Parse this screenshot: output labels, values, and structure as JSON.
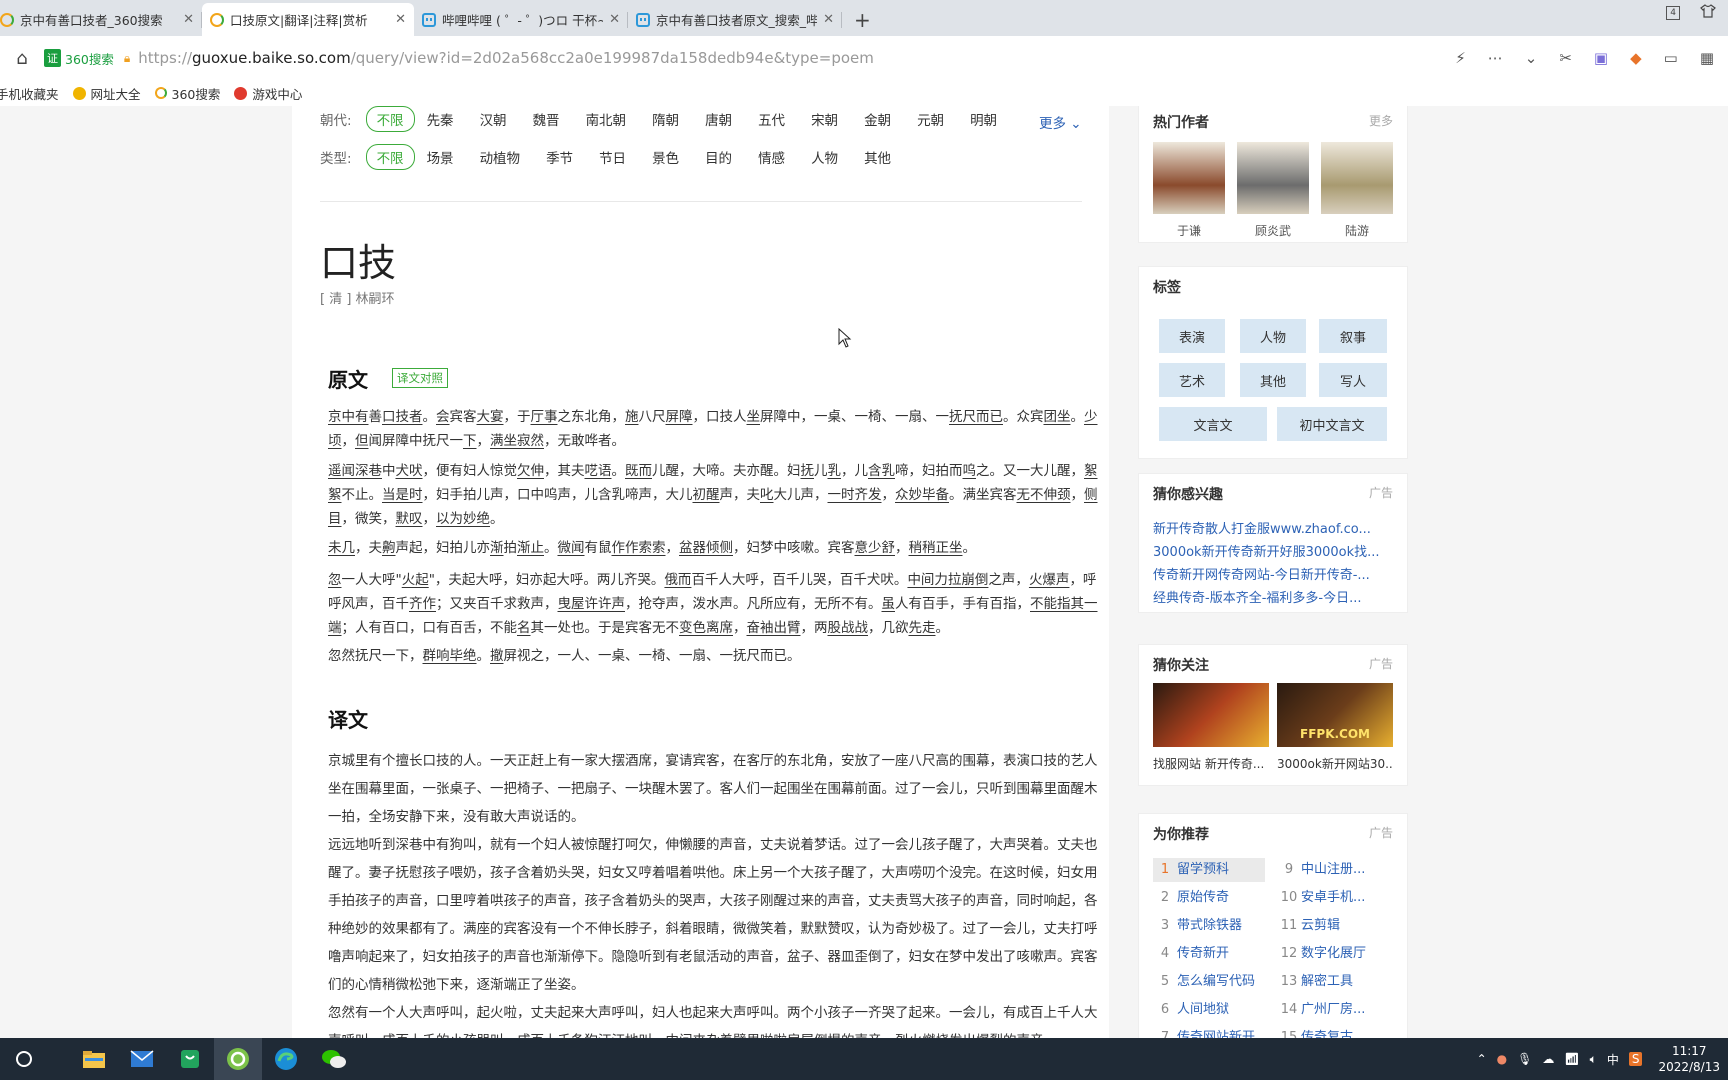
{
  "browser": {
    "tabs": [
      {
        "title": "京中有善口技者_360搜索",
        "icon": "360-icon",
        "width": 210
      },
      {
        "title": "口技原文|翻译|注释|赏析",
        "icon": "360-icon",
        "width": 212
      },
      {
        "title": "哔哩哔哩 ( ゜- ゜)つロ 干杯~-b",
        "icon": "bilibili-icon",
        "width": 214
      },
      {
        "title": "京中有善口技者原文_搜索_哔哩",
        "icon": "bilibili-icon",
        "width": 214
      }
    ],
    "active_tab": 1,
    "window_count": "4",
    "cert_label": "证",
    "search_source": "360搜索",
    "url_prefix": "https://",
    "url_domain": "guoxue.baike.so.com",
    "url_path": "/query/view?id=2d02a568cc2a0e199987da158dedb94e&type=poem",
    "bookmarks": [
      "手机收藏夹",
      "网址大全",
      "360搜索",
      "游戏中心"
    ]
  },
  "filters": {
    "dynasty_label": "朝代:",
    "dynasty_options": [
      "不限",
      "先秦",
      "汉朝",
      "魏晋",
      "南北朝",
      "隋朝",
      "唐朝",
      "五代",
      "宋朝",
      "金朝",
      "元朝",
      "明朝"
    ],
    "more_label": "更多 ⌄",
    "type_label": "类型:",
    "type_options": [
      "不限",
      "场景",
      "动植物",
      "季节",
      "节日",
      "景色",
      "目的",
      "情感",
      "人物",
      "其他"
    ]
  },
  "poem": {
    "title": "口技",
    "author": "[ 清 ] 林嗣环",
    "original_heading": "原文",
    "compare_button": "译文对照",
    "translation_heading": "译文"
  },
  "original": [
    [
      [
        "京中有",
        1
      ],
      [
        "善",
        0
      ],
      [
        "口技者",
        1
      ],
      [
        "。",
        0
      ],
      [
        "会",
        1
      ],
      [
        "宾客",
        0
      ],
      [
        "大宴",
        1
      ],
      [
        "，于",
        0
      ],
      [
        "厅事",
        1
      ],
      [
        "之东北角，",
        0
      ],
      [
        "施",
        1
      ],
      [
        "八尺",
        0
      ],
      [
        "屏障",
        1
      ],
      [
        "，口技人",
        0
      ],
      [
        "坐",
        1
      ],
      [
        "屏障中，一桌、一椅、一扇、一",
        0
      ],
      [
        "抚尺",
        1
      ],
      [
        "而已",
        1
      ],
      [
        "。众宾",
        0
      ],
      [
        "团坐",
        1
      ],
      [
        "。",
        0
      ],
      [
        "少顷",
        1
      ],
      [
        "，",
        0
      ],
      [
        "但",
        1
      ],
      [
        "闻屏障中抚尺一",
        0
      ],
      [
        "下",
        1
      ],
      [
        "，",
        0
      ],
      [
        "满坐寂然",
        1
      ],
      [
        "，无敢哗者。",
        0
      ]
    ],
    [
      [
        "遥闻",
        1
      ],
      [
        "深巷",
        1
      ],
      [
        "中",
        0
      ],
      [
        "犬吠",
        1
      ],
      [
        "，便有妇人惊觉",
        0
      ],
      [
        "欠伸",
        1
      ],
      [
        "，其夫",
        0
      ],
      [
        "呓语",
        1
      ],
      [
        "。",
        0
      ],
      [
        "既而",
        1
      ],
      [
        "儿醒，大啼。夫亦醒。妇",
        0
      ],
      [
        "抚",
        1
      ],
      [
        "儿",
        0
      ],
      [
        "乳",
        1
      ],
      [
        "，儿",
        0
      ],
      [
        "含乳",
        1
      ],
      [
        "啼，妇拍而",
        0
      ],
      [
        "呜",
        1
      ],
      [
        "之。又一大儿醒，",
        0
      ],
      [
        "絮絮",
        1
      ],
      [
        "不止。",
        0
      ],
      [
        "当是时",
        1
      ],
      [
        "，妇手拍儿声，口中呜声，儿含乳啼声，大儿",
        0
      ],
      [
        "初醒",
        1
      ],
      [
        "声，夫",
        0
      ],
      [
        "叱",
        1
      ],
      [
        "大儿声，",
        0
      ],
      [
        "一时齐发",
        1
      ],
      [
        "，",
        0
      ],
      [
        "众妙毕备",
        1
      ],
      [
        "。满坐宾客",
        0
      ],
      [
        "无不伸颈",
        1
      ],
      [
        "，",
        0
      ],
      [
        "侧目",
        1
      ],
      [
        "，微笑，",
        0
      ],
      [
        "默叹",
        1
      ],
      [
        "，",
        0
      ],
      [
        "以为妙绝",
        1
      ],
      [
        "。",
        0
      ]
    ],
    [
      [
        "未几",
        1
      ],
      [
        "，夫",
        0
      ],
      [
        "齁",
        1
      ],
      [
        "声起，妇拍儿亦",
        0
      ],
      [
        "渐",
        1
      ],
      [
        "拍",
        0
      ],
      [
        "渐止",
        1
      ],
      [
        "。",
        0
      ],
      [
        "微闻",
        1
      ],
      [
        "有鼠",
        0
      ],
      [
        "作作索索",
        1
      ],
      [
        "，",
        0
      ],
      [
        "盆器倾侧",
        1
      ],
      [
        "，妇梦中咳嗽。宾客",
        0
      ],
      [
        "意少舒",
        1
      ],
      [
        "，",
        0
      ],
      [
        "稍稍正坐",
        1
      ],
      [
        "。",
        0
      ]
    ],
    [
      [
        "忽",
        1
      ],
      [
        "一人大呼\"",
        0
      ],
      [
        "火起",
        1
      ],
      [
        "\"，夫起大呼，妇亦起大呼。两儿齐哭。",
        0
      ],
      [
        "俄而",
        1
      ],
      [
        "百千人大呼，百千儿哭，百千犬吠。",
        0
      ],
      [
        "中间力拉崩倒",
        1
      ],
      [
        "之声，",
        0
      ],
      [
        "火爆声",
        1
      ],
      [
        "，呼呼风声，百千",
        0
      ],
      [
        "齐作",
        1
      ],
      [
        "；又夹百千求救声，",
        0
      ],
      [
        "曳屋许许声",
        1
      ],
      [
        "，抢夺声，泼水声。凡所应有，无所不有。",
        0
      ],
      [
        "虽",
        1
      ],
      [
        "人有百手，手有百指，",
        0
      ],
      [
        "不能指其一端",
        1
      ],
      [
        "；人有百口，口有百舌，不能",
        0
      ],
      [
        "名",
        1
      ],
      [
        "其一处也。于是宾客无不",
        0
      ],
      [
        "变色离席",
        1
      ],
      [
        "，",
        0
      ],
      [
        "奋袖出臂",
        1
      ],
      [
        "，两",
        0
      ],
      [
        "股战战",
        1
      ],
      [
        "，几欲",
        0
      ],
      [
        "先走",
        1
      ],
      [
        "。",
        0
      ]
    ],
    [
      [
        "忽然抚尺一下，",
        0
      ],
      [
        "群响毕绝",
        1
      ],
      [
        "。",
        0
      ],
      [
        "撤",
        1
      ],
      [
        "屏视之，一人、一桌、一椅、一扇、一抚尺而已。",
        0
      ]
    ]
  ],
  "translation": [
    "京城里有个擅长口技的人。一天正赶上有一家大摆酒席，宴请宾客，在客厅的东北角，安放了一座八尺高的围幕，表演口技的艺人坐在围幕里面，一张桌子、一把椅子、一把扇子、一块醒木罢了。客人们一起围坐在围幕前面。过了一会儿，只听到围幕里面醒木一拍，全场安静下来，没有敢大声说话的。",
    "远远地听到深巷中有狗叫，就有一个妇人被惊醒打呵欠，伸懒腰的声音，丈夫说着梦话。过了一会儿孩子醒了，大声哭着。丈夫也醒了。妻子抚慰孩子喂奶，孩子含着奶头哭，妇女又哼着唱着哄他。床上另一个大孩子醒了，大声唠叨个没完。在这时候，妇女用手拍孩子的声音，口里哼着哄孩子的声音，孩子含着奶头的哭声，大孩子刚醒过来的声音，丈夫责骂大孩子的声音，同时响起，各种绝妙的效果都有了。满座的宾客没有一个不伸长脖子，斜着眼睛，微微笑着，默默赞叹，认为奇妙极了。过了一会儿，丈夫打呼噜声响起来了，妇女拍孩子的声音也渐渐停下。隐隐听到有老鼠活动的声音，盆子、器皿歪倒了，妇女在梦中发出了咳嗽声。宾客们的心情稍微松弛下来，逐渐端正了坐姿。",
    "忽然有一个人大声呼叫，起火啦，丈夫起来大声呼叫，妇人也起来大声呼叫。两个小孩子一齐哭了起来。一会儿，有成百上千人大声呼叫，成百上千的小孩哭叫，成百上千条狗汪汪地叫。中间夹杂着劈里啪啦房屋倒塌的声音，烈火燃烧发出爆裂的声音，"
  ],
  "sidebar": {
    "hot_authors": {
      "title": "热门作者",
      "more": "更多",
      "authors": [
        {
          "name": "于谦",
          "color": "#8a4a2c"
        },
        {
          "name": "顾炎武",
          "color": "#6c6c6c"
        },
        {
          "name": "陆游",
          "color": "#a89a70"
        }
      ]
    },
    "tags": {
      "title": "标签",
      "items": [
        "表演",
        "人物",
        "叙事",
        "艺术",
        "其他",
        "写人",
        "文言文",
        "初中文言文"
      ]
    },
    "interest": {
      "title": "猜你感兴趣",
      "ad": "广告",
      "links": [
        "新开传奇散人打金服www.zhaof.co...",
        "3000ok新开传奇新开好服3000ok找...",
        "传奇新开网传奇网站-今日新开传奇-...",
        "经典传奇-版本齐全-福利多多-今日..."
      ]
    },
    "follow": {
      "title": "猜你关注",
      "ad": "广告",
      "items": [
        {
          "caption": "找服网站 新开传奇...",
          "banner": "",
          "color": "#b0421e"
        },
        {
          "caption": "3000ok新开网站30...",
          "banner": "FFPK.COM",
          "color": "#6b3d1a"
        }
      ]
    },
    "recommend": {
      "title": "为你推荐",
      "ad": "广告",
      "left": [
        {
          "n": "1",
          "label": "留学预科"
        },
        {
          "n": "2",
          "label": "原始传奇"
        },
        {
          "n": "3",
          "label": "带式除铁器"
        },
        {
          "n": "4",
          "label": "传奇新开"
        },
        {
          "n": "5",
          "label": "怎么编写代码"
        },
        {
          "n": "6",
          "label": "人间地狱"
        },
        {
          "n": "7",
          "label": "传奇网站新开"
        }
      ],
      "right": [
        {
          "n": "9",
          "label": "中山注册..."
        },
        {
          "n": "10",
          "label": "安卓手机..."
        },
        {
          "n": "11",
          "label": "云剪辑"
        },
        {
          "n": "12",
          "label": "数字化展厅"
        },
        {
          "n": "13",
          "label": "解密工具"
        },
        {
          "n": "14",
          "label": "广州厂房..."
        },
        {
          "n": "15",
          "label": "传奇复古"
        }
      ]
    }
  },
  "taskbar": {
    "ime": "中",
    "time": "11:17",
    "date": "2022/8/13"
  },
  "colors": {
    "accent_green": "#3cab3a",
    "link_blue": "#2d62b5",
    "tag_bg": "#d8e7f3"
  }
}
